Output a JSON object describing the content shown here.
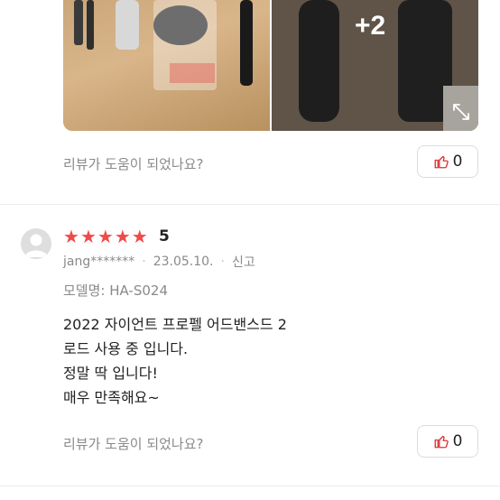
{
  "photos": {
    "more_count": "+2"
  },
  "previous_review": {
    "helpful_prompt": "리뷰가 도움이 되었나요?",
    "like_count": "0"
  },
  "review": {
    "stars": 5,
    "rating": "5",
    "user": "jang*******",
    "date": "23.05.10.",
    "report_label": "신고",
    "model": "모델명: HA-S024",
    "text_lines": [
      "2022 자이언트 프로펠 어드밴스드 2",
      "로드 사용 중 입니다.",
      "정말 딱 입니다!",
      "매우 만족해요~"
    ],
    "helpful_prompt": "리뷰가 도움이 되었나요?",
    "like_count": "0"
  },
  "colors": {
    "star": "#f04a4a",
    "like_icon": "#e03131"
  },
  "icons": [
    "expand-icon",
    "thumbs-up-icon",
    "user-avatar-icon",
    "star-icon"
  ]
}
